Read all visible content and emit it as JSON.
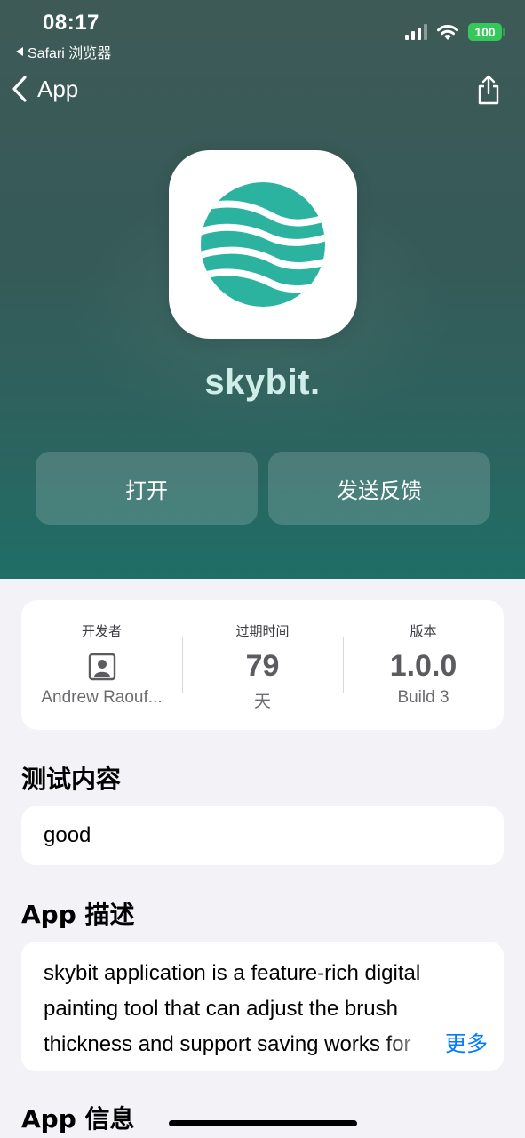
{
  "status": {
    "time": "08:17",
    "back_app": "Safari 浏览器",
    "battery": "100"
  },
  "nav": {
    "back_label": "App"
  },
  "app": {
    "name": "skybit.",
    "open_label": "打开",
    "feedback_label": "发送反馈"
  },
  "info": {
    "developer": {
      "label": "开发者",
      "value": "Andrew Raouf..."
    },
    "expiry": {
      "label": "过期时间",
      "value": "79",
      "unit": "天"
    },
    "version": {
      "label": "版本",
      "value": "1.0.0",
      "build": "Build 3"
    }
  },
  "test_content": {
    "title": "测试内容",
    "text": "good"
  },
  "description": {
    "title": "App 描述",
    "text": "skybit application is a feature-rich digital painting tool that can adjust the brush thickness and support saving works for",
    "more_label": "更多"
  },
  "app_info": {
    "title": "App 信息"
  },
  "colors": {
    "accent": "#007aff",
    "battery": "#34c759",
    "icon_teal": "#2bb3a0"
  }
}
